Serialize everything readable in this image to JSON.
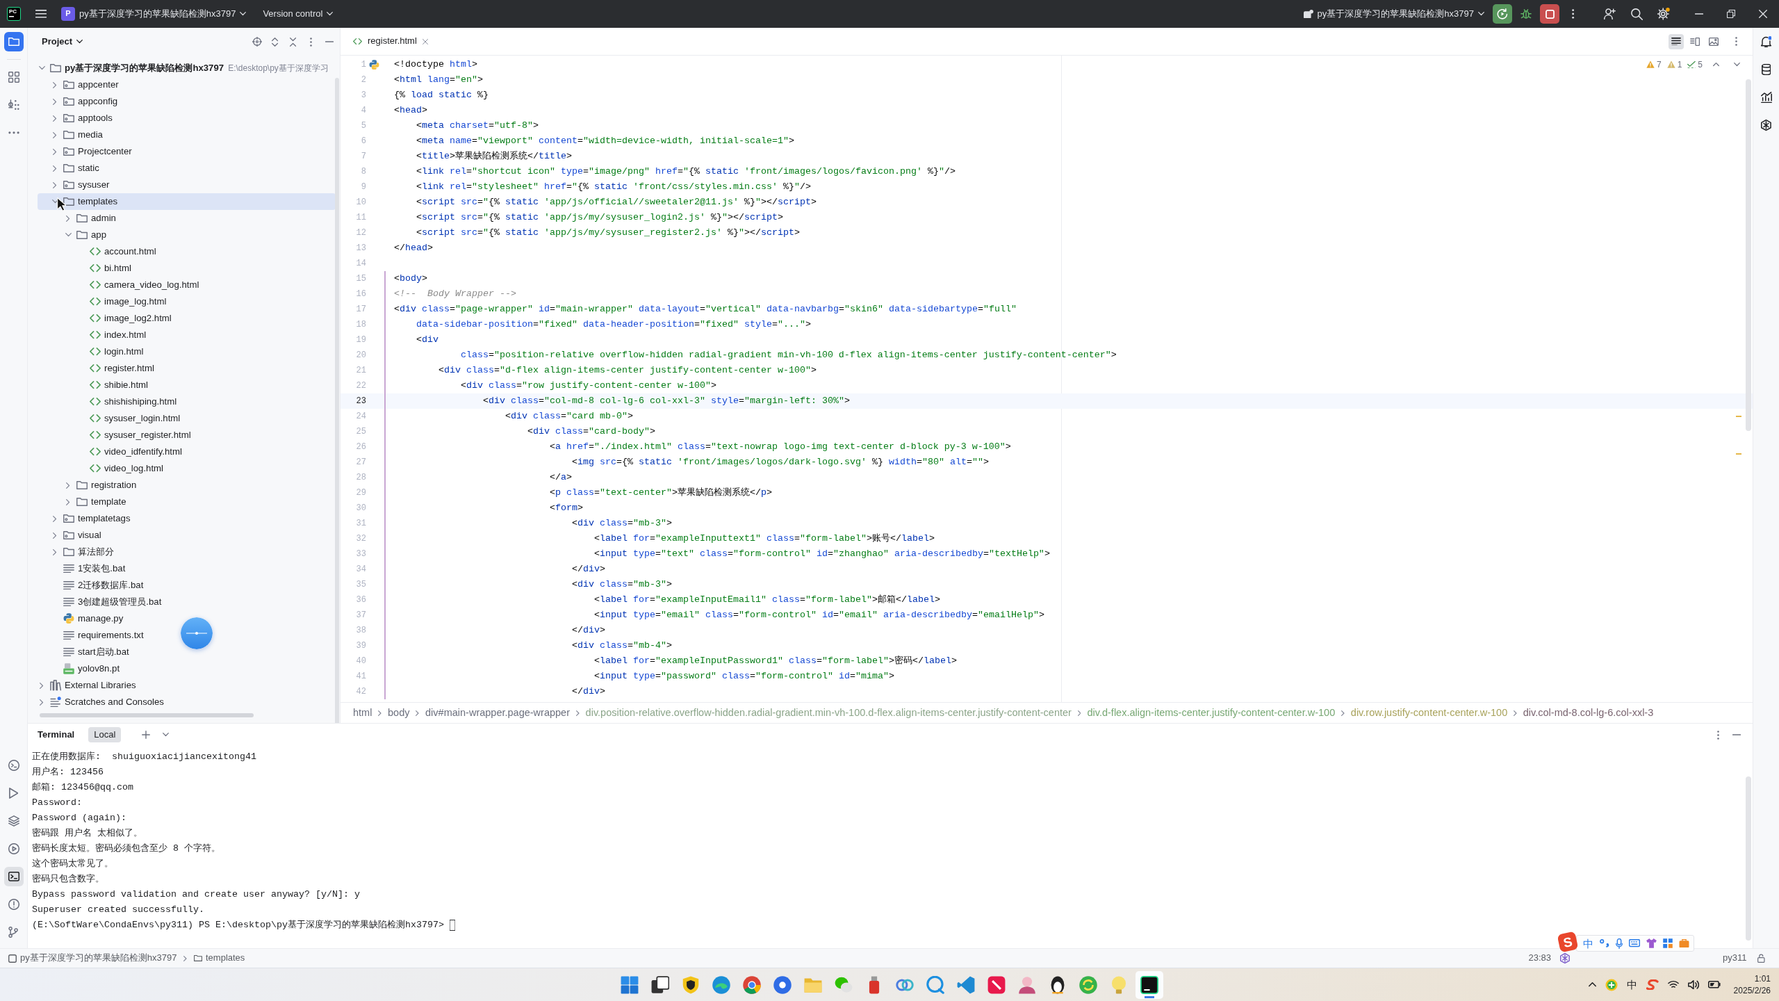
{
  "title_bar": {
    "logo_text": "PC",
    "project_badge": "P",
    "project": "py基于深度学习的苹果缺陷检测hx3797",
    "vcs": "Version control",
    "run_config": "py基于深度学习的苹果缺陷检测hx3797"
  },
  "left_toolbar": {
    "top": [
      {
        "kind": "project",
        "selected": true
      },
      {
        "kind": "structure",
        "selected": false
      },
      {
        "kind": "packages",
        "selected": false
      },
      {
        "kind": "more",
        "selected": false
      }
    ],
    "bottom": [
      {
        "kind": "console",
        "selected": false
      },
      {
        "kind": "run",
        "selected": false
      },
      {
        "kind": "layers",
        "selected": false
      },
      {
        "kind": "services",
        "selected": false
      },
      {
        "kind": "terminal",
        "selected": true
      },
      {
        "kind": "problems",
        "selected": false
      },
      {
        "kind": "git",
        "selected": false
      }
    ]
  },
  "project_panel": {
    "title": "Project",
    "tree": [
      {
        "name": "py基于深度学习的苹果缺陷检测hx3797",
        "path": "E:\\desktop\\py基于深度学习",
        "kind": "folder",
        "expanded": true,
        "selected": false,
        "children": [
          {
            "name": "appcenter",
            "kind": "package",
            "expanded": false,
            "selected": false
          },
          {
            "name": "appconfig",
            "kind": "package",
            "expanded": false,
            "selected": false
          },
          {
            "name": "apptools",
            "kind": "package",
            "expanded": false,
            "selected": false
          },
          {
            "name": "media",
            "kind": "folder",
            "expanded": false,
            "selected": false
          },
          {
            "name": "Projectcenter",
            "kind": "package",
            "expanded": false,
            "selected": false
          },
          {
            "name": "static",
            "kind": "folder",
            "expanded": false,
            "selected": false
          },
          {
            "name": "sysuser",
            "kind": "package",
            "expanded": false,
            "selected": false
          },
          {
            "name": "templates",
            "kind": "folder",
            "expanded": true,
            "selected": true,
            "children": [
              {
                "name": "admin",
                "kind": "folder",
                "expanded": false,
                "selected": false
              },
              {
                "name": "app",
                "kind": "folder",
                "expanded": true,
                "selected": false,
                "children": [
                  {
                    "name": "account.html",
                    "kind": "html",
                    "selected": false
                  },
                  {
                    "name": "bi.html",
                    "kind": "html",
                    "selected": false
                  },
                  {
                    "name": "camera_video_log.html",
                    "kind": "html",
                    "selected": false
                  },
                  {
                    "name": "image_log.html",
                    "kind": "html",
                    "selected": false
                  },
                  {
                    "name": "image_log2.html",
                    "kind": "html",
                    "selected": false
                  },
                  {
                    "name": "index.html",
                    "kind": "html",
                    "selected": false
                  },
                  {
                    "name": "login.html",
                    "kind": "html",
                    "selected": false
                  },
                  {
                    "name": "register.html",
                    "kind": "html",
                    "selected": false
                  },
                  {
                    "name": "shibie.html",
                    "kind": "html",
                    "selected": false
                  },
                  {
                    "name": "shishishiping.html",
                    "kind": "html",
                    "selected": false
                  },
                  {
                    "name": "sysuser_login.html",
                    "kind": "html",
                    "selected": false
                  },
                  {
                    "name": "sysuser_register.html",
                    "kind": "html",
                    "selected": false
                  },
                  {
                    "name": "video_idfentify.html",
                    "kind": "html",
                    "selected": false
                  },
                  {
                    "name": "video_log.html",
                    "kind": "html",
                    "selected": false
                  }
                ]
              },
              {
                "name": "registration",
                "kind": "folder",
                "expanded": false,
                "selected": false
              },
              {
                "name": "template",
                "kind": "folder",
                "expanded": false,
                "selected": false
              }
            ]
          },
          {
            "name": "templatetags",
            "kind": "package",
            "expanded": false,
            "selected": false
          },
          {
            "name": "visual",
            "kind": "package",
            "expanded": false,
            "selected": false
          },
          {
            "name": "算法部分",
            "kind": "folder",
            "expanded": false,
            "selected": false
          },
          {
            "name": "1安装包.bat",
            "kind": "text",
            "selected": false
          },
          {
            "name": "2迁移数据库.bat",
            "kind": "text",
            "selected": false
          },
          {
            "name": "3创建超级管理员.bat",
            "kind": "text",
            "selected": false
          },
          {
            "name": "manage.py",
            "kind": "python",
            "selected": false
          },
          {
            "name": "requirements.txt",
            "kind": "text",
            "selected": false
          },
          {
            "name": "start启动.bat",
            "kind": "text",
            "selected": false
          },
          {
            "name": "yolov8n.pt",
            "kind": "model",
            "selected": false
          }
        ]
      },
      {
        "name": "External Libraries",
        "kind": "library",
        "expanded": false,
        "selected": false
      },
      {
        "name": "Scratches and Consoles",
        "kind": "scratches",
        "expanded": false,
        "selected": false
      }
    ]
  },
  "editor": {
    "tabs": [
      {
        "label": "register.html",
        "selected": true
      }
    ],
    "view_modes": [
      {
        "kind": "code",
        "selected": true
      },
      {
        "kind": "split",
        "selected": false
      },
      {
        "kind": "preview",
        "selected": false
      }
    ],
    "inspections": [
      {
        "kind": "warning",
        "count": "7"
      },
      {
        "kind": "weak_warning",
        "count": "1"
      },
      {
        "kind": "typo",
        "count": "5"
      }
    ],
    "lines": [
      {
        "number": "1",
        "text": "<!doctype html>",
        "selected": false,
        "changed": false
      },
      {
        "number": "2",
        "text": "<html lang=\"en\">",
        "selected": false,
        "changed": false
      },
      {
        "number": "3",
        "text": "{% load static %}",
        "selected": false,
        "changed": false
      },
      {
        "number": "4",
        "text": "<head>",
        "selected": false,
        "changed": false
      },
      {
        "number": "5",
        "text": "    <meta charset=\"utf-8\">",
        "selected": false,
        "changed": false
      },
      {
        "number": "6",
        "text": "    <meta name=\"viewport\" content=\"width=device-width, initial-scale=1\">",
        "selected": false,
        "changed": false
      },
      {
        "number": "7",
        "text": "    <title>苹果缺陷检测系统</title>",
        "selected": false,
        "changed": false
      },
      {
        "number": "8",
        "text": "    <link rel=\"shortcut icon\" type=\"image/png\" href=\"{% static 'front/images/logos/favicon.png' %}\"/>",
        "selected": false,
        "changed": false
      },
      {
        "number": "9",
        "text": "    <link rel=\"stylesheet\" href=\"{% static 'front/css/styles.min.css' %}\"/>",
        "selected": false,
        "changed": false
      },
      {
        "number": "10",
        "text": "    <script src=\"{% static 'app/js/official//sweetaler2@11.js' %}\"></script>",
        "selected": false,
        "changed": false
      },
      {
        "number": "11",
        "text": "    <script src=\"{% static 'app/js/my/sysuser_login2.js' %}\"></script>",
        "selected": false,
        "changed": false
      },
      {
        "number": "12",
        "text": "    <script src=\"{% static 'app/js/my/sysuser_register2.js' %}\"></script>",
        "selected": false,
        "changed": false
      },
      {
        "number": "13",
        "text": "</head>",
        "selected": false,
        "changed": false
      },
      {
        "number": "14",
        "selected": false,
        "changed": false
      },
      {
        "number": "15",
        "text": "<body>",
        "selected": false,
        "changed": true
      },
      {
        "number": "16",
        "text": "<!--  Body Wrapper -->",
        "selected": false,
        "changed": true
      },
      {
        "number": "17",
        "text": "<div class=\"page-wrapper\" id=\"main-wrapper\" data-layout=\"vertical\" data-navbarbg=\"skin6\" data-sidebartype=\"full\"",
        "selected": false,
        "changed": true
      },
      {
        "number": "18",
        "text": "    data-sidebar-position=\"fixed\" data-header-position=\"fixed\" style=\"...\">",
        "selected": false,
        "changed": true
      },
      {
        "number": "19",
        "text": "    <div",
        "selected": false,
        "changed": true
      },
      {
        "number": "20",
        "text": "            class=\"position-relative overflow-hidden radial-gradient min-vh-100 d-flex align-items-center justify-content-center\">",
        "selected": false,
        "changed": true
      },
      {
        "number": "21",
        "text": "        <div class=\"d-flex align-items-center justify-content-center w-100\">",
        "selected": false,
        "changed": true
      },
      {
        "number": "22",
        "text": "            <div class=\"row justify-content-center w-100\">",
        "selected": false,
        "changed": true
      },
      {
        "number": "23",
        "text": "                <div class=\"col-md-8 col-lg-6 col-xxl-3\" style=\"margin-left: 30%\">",
        "selected": true,
        "changed": true
      },
      {
        "number": "24",
        "text": "                    <div class=\"card mb-0\">",
        "selected": false,
        "changed": true
      },
      {
        "number": "25",
        "text": "                        <div class=\"card-body\">",
        "selected": false,
        "changed": true
      },
      {
        "number": "26",
        "text": "                            <a href=\"./index.html\" class=\"text-nowrap logo-img text-center d-block py-3 w-100\">",
        "selected": false,
        "changed": true
      },
      {
        "number": "27",
        "text": "                                <img src={% static 'front/images/logos/dark-logo.svg' %} width=\"80\" alt=\"\">",
        "selected": false,
        "changed": true
      },
      {
        "number": "28",
        "text": "                            </a>",
        "selected": false,
        "changed": true
      },
      {
        "number": "29",
        "text": "                            <p class=\"text-center\">苹果缺陷检测系统</p>",
        "selected": false,
        "changed": true
      },
      {
        "number": "30",
        "text": "                            <form>",
        "selected": false,
        "changed": true
      },
      {
        "number": "31",
        "text": "                                <div class=\"mb-3\">",
        "selected": false,
        "changed": true
      },
      {
        "number": "32",
        "text": "                                    <label for=\"exampleInputtext1\" class=\"form-label\">账号</label>",
        "selected": false,
        "changed": true
      },
      {
        "number": "33",
        "text": "                                    <input type=\"text\" class=\"form-control\" id=\"zhanghao\" aria-describedby=\"textHelp\">",
        "selected": false,
        "changed": true
      },
      {
        "number": "34",
        "text": "                                </div>",
        "selected": false,
        "changed": true
      },
      {
        "number": "35",
        "text": "                                <div class=\"mb-3\">",
        "selected": false,
        "changed": true
      },
      {
        "number": "36",
        "text": "                                    <label for=\"exampleInputEmail1\" class=\"form-label\">邮箱</label>",
        "selected": false,
        "changed": true
      },
      {
        "number": "37",
        "text": "                                    <input type=\"email\" class=\"form-control\" id=\"email\" aria-describedby=\"emailHelp\">",
        "selected": false,
        "changed": true
      },
      {
        "number": "38",
        "text": "                                </div>",
        "selected": false,
        "changed": true
      },
      {
        "number": "39",
        "text": "                                <div class=\"mb-4\">",
        "selected": false,
        "changed": true
      },
      {
        "number": "40",
        "text": "                                    <label for=\"exampleInputPassword1\" class=\"form-label\">密码</label>",
        "selected": false,
        "changed": true
      },
      {
        "number": "41",
        "text": "                                    <input type=\"password\" class=\"form-control\" id=\"mima\">",
        "selected": false,
        "changed": true
      },
      {
        "number": "42",
        "text": "                                </div>",
        "selected": false,
        "changed": true
      }
    ],
    "breadcrumbs": [
      {
        "label": "html",
        "color": "#6c707e"
      },
      {
        "label": "body",
        "color": "#6c707e"
      },
      {
        "label": "div#main-wrapper.page-wrapper",
        "color": "#6c707e"
      },
      {
        "label": "div.position-relative.overflow-hidden.radial-gradient.min-vh-100.d-flex.align-items-center.justify-content-center",
        "color": "#8ca58a"
      },
      {
        "label": "div.d-flex.align-items-center.justify-content-center.w-100",
        "color": "#78a874"
      },
      {
        "label": "div.row.justify-content-center.w-100",
        "color": "#a9a35c"
      },
      {
        "label": "div.col-md-8.col-lg-6.col-xxl-3",
        "color": "#7a6470"
      }
    ]
  },
  "right_toolbar": [
    {
      "kind": "notifications"
    },
    {
      "kind": "database"
    },
    {
      "kind": "chart"
    },
    {
      "kind": "ai"
    }
  ],
  "terminal": {
    "title": "Terminal",
    "tabs": [
      {
        "label": "Local",
        "selected": true
      }
    ],
    "lines": [
      "正在使用数据库:  shuiguoxiacijiancexitong41",
      "用户名: 123456",
      "邮箱: 123456@qq.com",
      "Password:",
      "Password (again):",
      "密码跟 用户名 太相似了。",
      "密码长度太短。密码必须包含至少 8 个字符。",
      "这个密码太常见了。",
      "密码只包含数字。",
      "Bypass password validation and create user anyway? [y/N]: y",
      "Superuser created successfully.",
      "(E:\\SoftWare\\CondaEnvs\\py311) PS E:\\desktop\\py基于深度学习的苹果缺陷检测hx3797>"
    ]
  },
  "status_bar": {
    "path": [
      {
        "kind": "module",
        "label": "py基于深度学习的苹果缺陷检测hx3797"
      },
      {
        "kind": "folder",
        "label": "templates"
      }
    ],
    "position": "23:83",
    "interpreter": "py311"
  },
  "ime_bar": {
    "logo": "S",
    "mode": "中"
  },
  "taskbar": {
    "apps": [
      {
        "kind": "start",
        "active": false
      },
      {
        "kind": "task_view",
        "active": false
      },
      {
        "kind": "shield",
        "active": false
      },
      {
        "kind": "swirl",
        "active": false
      },
      {
        "kind": "segmented_circle",
        "active": false
      },
      {
        "kind": "dot_circle",
        "active": false
      },
      {
        "kind": "folder",
        "active": false
      },
      {
        "kind": "chat_bubbles",
        "active": false
      },
      {
        "kind": "usb",
        "active": false
      },
      {
        "kind": "rings",
        "active": false
      },
      {
        "kind": "chat_circle",
        "active": false
      },
      {
        "kind": "ribbon",
        "active": false
      },
      {
        "kind": "tile",
        "active": false
      },
      {
        "kind": "person",
        "active": false
      },
      {
        "kind": "penguin",
        "active": false
      },
      {
        "kind": "arrows_circle",
        "active": false
      },
      {
        "kind": "bulb",
        "active": false
      },
      {
        "kind": "ide",
        "active": true
      }
    ],
    "input_indicator": "中",
    "time": "1:01",
    "date": "2025/2/26"
  }
}
